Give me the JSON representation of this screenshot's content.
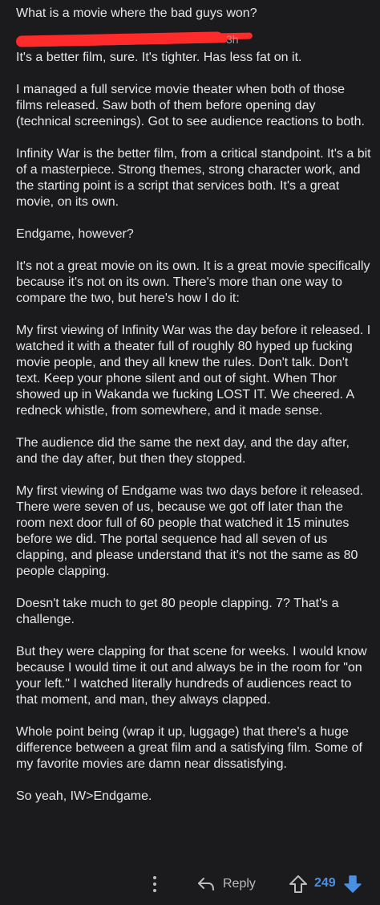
{
  "post": {
    "title": "What is a movie where the bad guys won?"
  },
  "comment": {
    "timestamp": "3h",
    "paragraphs": [
      "It's a better film, sure.  It's tighter.  Has less fat on it.",
      "I managed a full service movie theater when both of those films released.  Saw both of them before opening day (technical screenings).  Got to see audience reactions to both.",
      "Infinity War is the better film, from a critical standpoint.  It's a bit of a masterpiece.  Strong themes, strong character work, and the starting point is a script that services both.  It's a great movie, on its own.",
      "Endgame, however?",
      "It's not a great movie on its own.  It is a great movie specifically because it's not on its own.  There's more than one way to compare the two, but here's how I do it:",
      "My first viewing of Infinity War was the day before it released.  I watched it with a theater full of roughly 80 hyped up fucking movie people, and they all knew the rules.  Don't talk. Don't text.  Keep your phone silent and out of sight.  When Thor showed up in Wakanda we fucking LOST IT.  We cheered.  A redneck whistle, from somewhere, and it made sense.",
      "The audience did the same the next day, and the day after, and the day after, but then they stopped.",
      "My first viewing of Endgame was two days before it released.  There were seven of us, because we got off later than the room next door full of 60 people that watched it 15 minutes before we did.  The portal sequence had all seven of us clapping, and please understand that it's not the same as 80 people clapping.",
      "Doesn't take much to get 80 people clapping.  7?  That's a challenge.",
      "But they were clapping for that scene for weeks.  I would know because I would time it out and always be in the room for \"on your left.\" I watched literally hundreds of audiences react to that moment, and man, they always clapped.",
      "Whole point being (wrap it up, luggage) that there's a huge difference between a great film and a satisfying film.  Some of my favorite movies are damn near dissatisfying.",
      "So yeah, IW>Endgame."
    ]
  },
  "actions": {
    "reply_label": "Reply",
    "score": "249",
    "more_icon": "more-vertical-icon",
    "reply_icon": "reply-arrow-icon",
    "upvote_icon": "upvote-arrow-icon",
    "downvote_icon": "downvote-arrow-icon"
  },
  "colors": {
    "background": "#1b1b1d",
    "text": "#e6e6e6",
    "muted": "#9a9a9a",
    "redaction": "#ff2a2a",
    "accent": "#4a90e2"
  }
}
